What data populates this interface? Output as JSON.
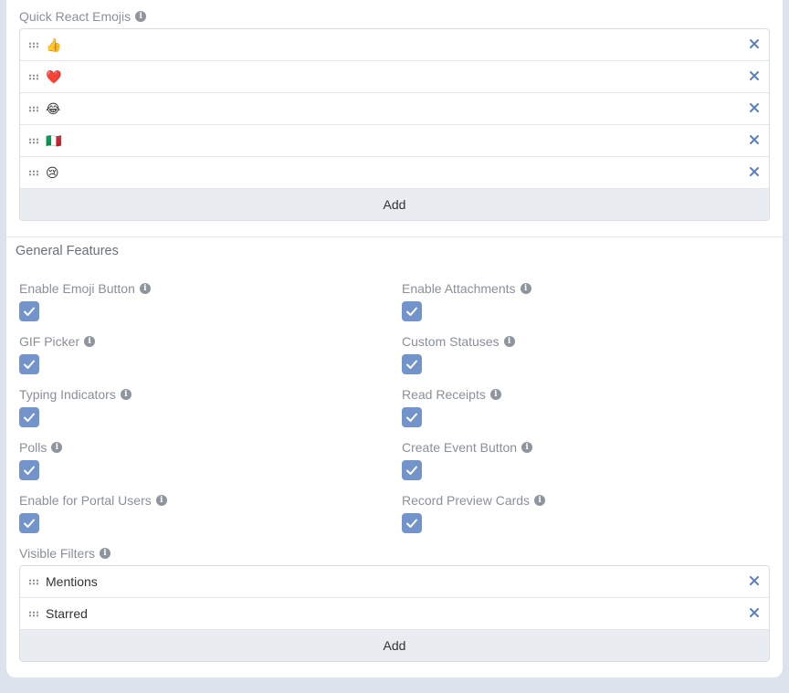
{
  "quick_react": {
    "label": "Quick React Emojis",
    "items": [
      "👍",
      "❤️",
      "😂",
      "🇮🇹",
      "😢"
    ],
    "add_label": "Add"
  },
  "general_features": {
    "heading": "General Features",
    "left": [
      {
        "label": "Enable Emoji Button",
        "checked": true
      },
      {
        "label": "GIF Picker",
        "checked": true
      },
      {
        "label": "Typing Indicators",
        "checked": true
      },
      {
        "label": "Polls",
        "checked": true
      },
      {
        "label": "Enable for Portal Users",
        "checked": true
      }
    ],
    "right": [
      {
        "label": "Enable Attachments",
        "checked": true
      },
      {
        "label": "Custom Statuses",
        "checked": true
      },
      {
        "label": "Read Receipts",
        "checked": true
      },
      {
        "label": "Create Event Button",
        "checked": true
      },
      {
        "label": "Record Preview Cards",
        "checked": true
      }
    ]
  },
  "visible_filters": {
    "label": "Visible Filters",
    "items": [
      "Mentions",
      "Starred"
    ],
    "add_label": "Add"
  },
  "colors": {
    "checkbox": "#7394cb",
    "remove_icon": "#5b7fbf",
    "add_button_bg": "#e9ecf0"
  },
  "icons": {
    "info": "info-icon",
    "drag": "drag-handle-icon",
    "remove": "close-icon",
    "check": "checkmark-icon"
  }
}
